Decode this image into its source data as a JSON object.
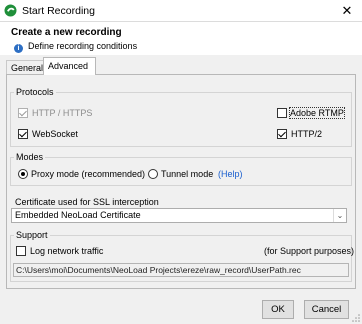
{
  "window": {
    "title": "Start Recording",
    "close_glyph": "✕",
    "app_icon": "neoload-recording-icon"
  },
  "header": {
    "title": "Create a new recording",
    "subtitle": "Define recording conditions",
    "info_glyph": "i"
  },
  "tabs": [
    {
      "label": "General",
      "selected": false
    },
    {
      "label": "Advanced",
      "selected": true
    }
  ],
  "protocols": {
    "legend": "Protocols",
    "items": [
      {
        "label": "HTTP / HTTPS",
        "checked": true,
        "enabled": false
      },
      {
        "label": "Adobe RTMP",
        "checked": false,
        "enabled": true
      },
      {
        "label": "WebSocket",
        "checked": true,
        "enabled": true
      },
      {
        "label": "HTTP/2",
        "checked": true,
        "enabled": true
      }
    ]
  },
  "modes": {
    "legend": "Modes",
    "proxy_label": "Proxy mode (recommended)",
    "tunnel_label": "Tunnel mode",
    "help_label": "(Help)",
    "selected": "proxy"
  },
  "certificate": {
    "legend": "Certificate used for SSL interception",
    "selected": "Embedded NeoLoad Certificate",
    "arrow_glyph": "⌄"
  },
  "support": {
    "legend": "Support",
    "log_label": "Log network traffic",
    "log_checked": false,
    "note": "(for Support purposes)",
    "path": "C:\\Users\\moi\\Documents\\NeoLoad Projects\\ereze\\raw_record\\UserPath.rec"
  },
  "buttons": {
    "ok": "OK",
    "cancel": "Cancel"
  },
  "colors": {
    "link": "#1a5fcf",
    "info": "#2d6fc4",
    "app_icon": "#1f8f3a"
  }
}
